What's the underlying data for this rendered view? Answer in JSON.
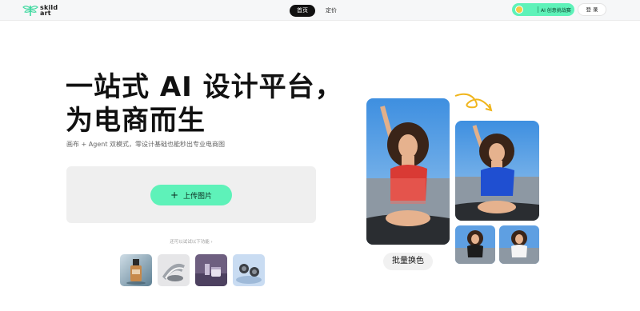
{
  "header": {
    "logo_text_line1": "skild",
    "logo_text_line2": "art",
    "tabs": [
      {
        "label": "首页",
        "active": true
      },
      {
        "label": "定价",
        "active": false
      }
    ],
    "promo": {
      "small_text": "",
      "label": "AI 创意挑战赛"
    },
    "login_label": "登 录"
  },
  "hero": {
    "title_line1": "一站式 AI 设计平台，",
    "title_line2": "为电商而生",
    "subtitle": "画布 + Agent 双模式，零设计基础也能秒出专业电商图"
  },
  "upload": {
    "button_label": "上传图片",
    "try_text": "还可以试试以下功能 ›"
  },
  "samples": [
    {
      "name": "serum-bottle-sample"
    },
    {
      "name": "metal-product-sample"
    },
    {
      "name": "cosmetic-jar-sample"
    },
    {
      "name": "earbuds-sample"
    }
  ],
  "showcase": {
    "label": "批量换色"
  },
  "colors": {
    "accent": "#5ef2b9",
    "topbar_bg": "#f6f7f8",
    "dark": "#111111"
  }
}
